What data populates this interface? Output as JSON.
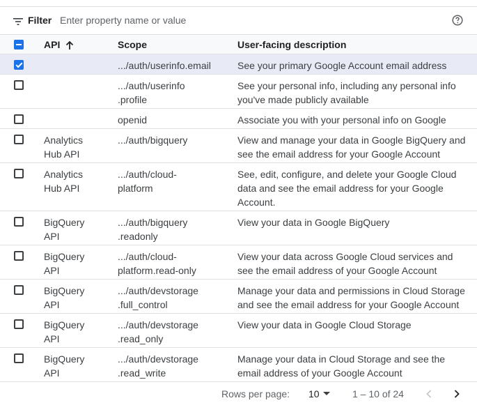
{
  "filter": {
    "label": "Filter",
    "placeholder": "Enter property name or value",
    "filter_icon": "filter-lines-icon",
    "help_icon": "help-circle-icon"
  },
  "table": {
    "columns": {
      "api": "API",
      "scope": "Scope",
      "description": "User-facing description",
      "sort_icon": "arrow-up-icon"
    },
    "select_all_state": "indeterminate",
    "rows": [
      {
        "checked": true,
        "api": [],
        "scope": [
          ".../auth/userinfo.email"
        ],
        "desc": [
          "See your primary Google Account email address"
        ]
      },
      {
        "checked": false,
        "api": [],
        "scope": [
          ".../auth/userinfo",
          ".profile"
        ],
        "desc": [
          "See your personal info, including any personal info",
          "you've made publicly available"
        ]
      },
      {
        "checked": false,
        "api": [],
        "scope": [
          "openid"
        ],
        "desc": [
          "Associate you with your personal info on Google"
        ]
      },
      {
        "checked": false,
        "api": [
          "Analytics",
          "Hub API"
        ],
        "scope": [
          ".../auth/bigquery"
        ],
        "desc": [
          "View and manage your data in Google BigQuery and",
          "see the email address for your Google Account"
        ]
      },
      {
        "checked": false,
        "api": [
          "Analytics",
          "Hub API"
        ],
        "scope": [
          ".../auth/cloud-",
          "platform"
        ],
        "desc": [
          "See, edit, configure, and delete your Google Cloud",
          "data and see the email address for your Google",
          "Account."
        ]
      },
      {
        "checked": false,
        "api": [
          "BigQuery",
          "API"
        ],
        "scope": [
          ".../auth/bigquery",
          ".readonly"
        ],
        "desc": [
          "View your data in Google BigQuery"
        ]
      },
      {
        "checked": false,
        "api": [
          "BigQuery",
          "API"
        ],
        "scope": [
          ".../auth/cloud-",
          "platform.read-only"
        ],
        "desc": [
          "View your data across Google Cloud services and",
          "see the email address of your Google Account"
        ]
      },
      {
        "checked": false,
        "api": [
          "BigQuery",
          "API"
        ],
        "scope": [
          ".../auth/devstorage",
          ".full_control"
        ],
        "desc": [
          "Manage your data and permissions in Cloud Storage",
          "and see the email address for your Google Account"
        ]
      },
      {
        "checked": false,
        "api": [
          "BigQuery",
          "API"
        ],
        "scope": [
          ".../auth/devstorage",
          ".read_only"
        ],
        "desc": [
          "View your data in Google Cloud Storage"
        ]
      },
      {
        "checked": false,
        "api": [
          "BigQuery",
          "API"
        ],
        "scope": [
          ".../auth/devstorage",
          ".read_write"
        ],
        "desc": [
          "Manage your data in Cloud Storage and see the",
          "email address of your Google Account"
        ]
      }
    ]
  },
  "pagination": {
    "rows_label": "Rows per page:",
    "rows_value": "10",
    "range": "1 – 10 of 24",
    "prev_icon": "chevron-left-icon",
    "next_icon": "chevron-right-icon"
  },
  "colors": {
    "accent": "#1a73e8",
    "selected_row": "#e8eaf6",
    "header_bg": "#f8f9fa"
  }
}
